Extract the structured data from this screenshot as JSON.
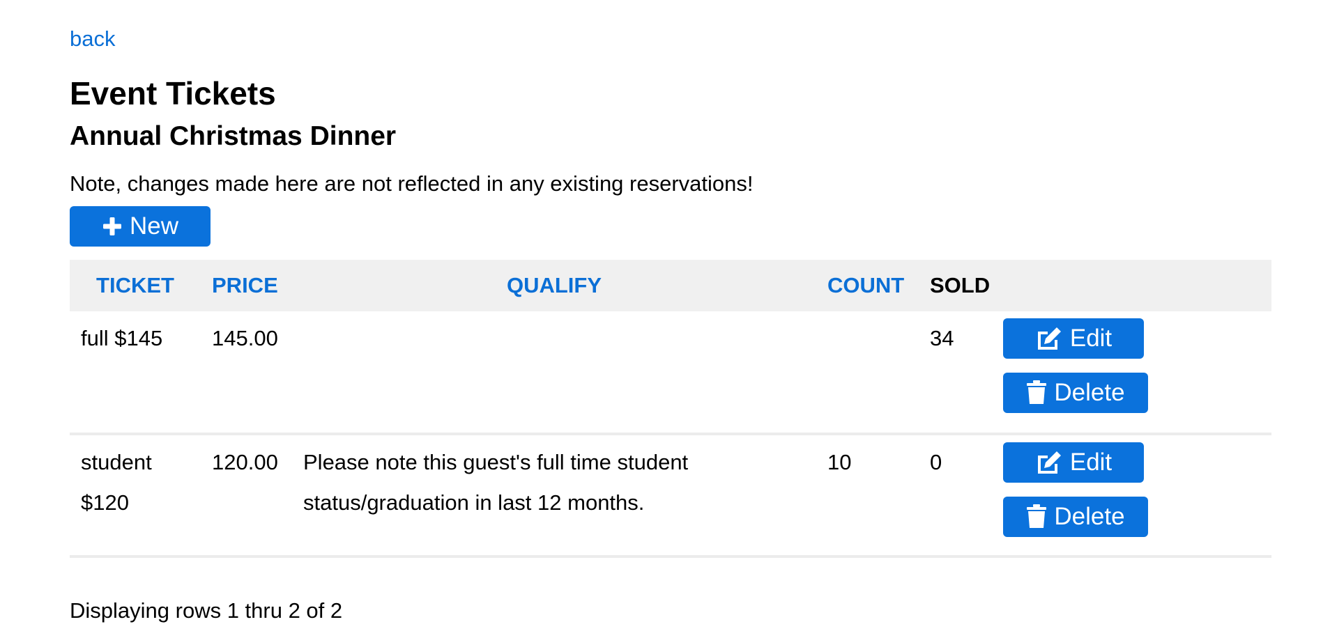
{
  "nav": {
    "back_label": "back"
  },
  "header": {
    "title": "Event Tickets",
    "event_name": "Annual Christmas Dinner",
    "note": "Note, changes made here are not reflected in any existing reservations!"
  },
  "toolbar": {
    "new_label": "New"
  },
  "table": {
    "columns": [
      "TICKET",
      "PRICE",
      "QUALIFY",
      "COUNT",
      "SOLD"
    ],
    "rows": [
      {
        "ticket": "full $145",
        "price": "145.00",
        "qualify": "",
        "count": "",
        "sold": "34"
      },
      {
        "ticket": "student $120",
        "price": "120.00",
        "qualify": "Please note this guest's full time student status/graduation in last 12 months.",
        "count": "10",
        "sold": "0"
      }
    ],
    "edit_label": "Edit",
    "delete_label": "Delete"
  },
  "footer": {
    "status": "Displaying rows 1 thru 2 of 2"
  },
  "colors": {
    "accent": "#0b72dc",
    "link": "#0b6fd6",
    "header_bg": "#f0f0f0"
  },
  "icons": {
    "new": "plus-icon",
    "edit": "edit-icon",
    "delete": "trash-icon"
  }
}
